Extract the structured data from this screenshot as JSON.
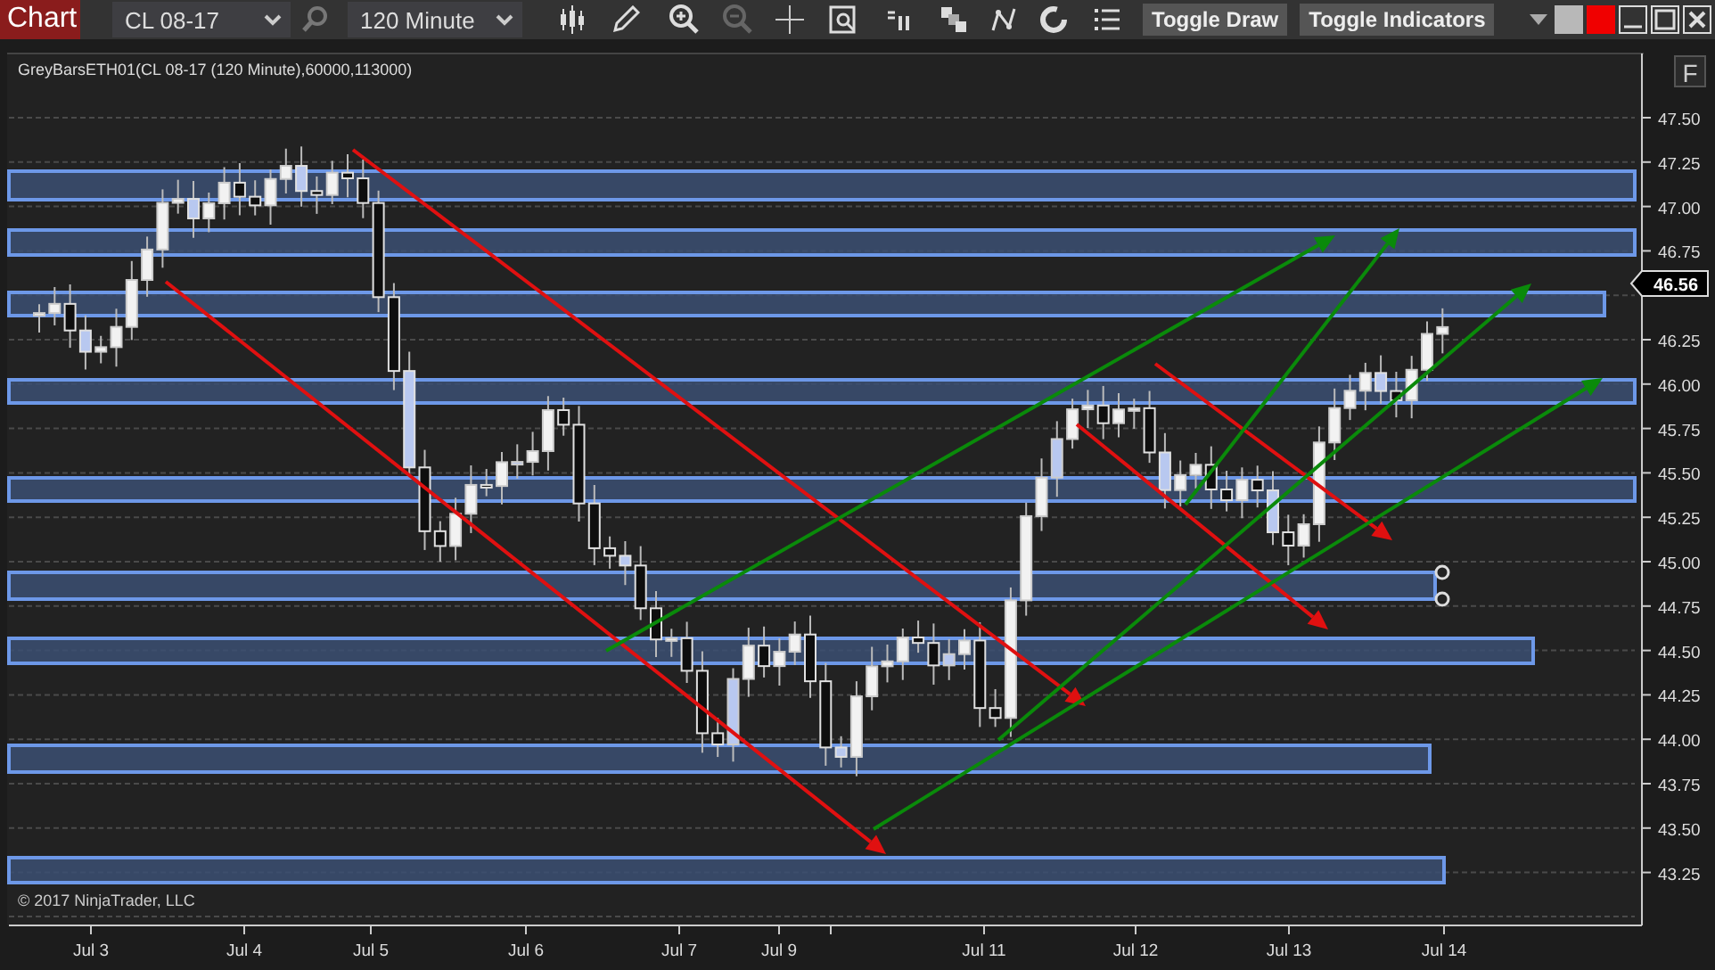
{
  "toolbar": {
    "app_title": "Chart",
    "instrument": "CL 08-17",
    "interval": "120 Minute",
    "buttons": [
      "Toggle Draw",
      "Toggle Indicators"
    ]
  },
  "chart": {
    "title": "GreyBarsETH01(CL 08-17 (120 Minute),60000,113000)",
    "panel_button": "F",
    "price_marker": "46.56",
    "y_axis_labels": [
      "47.50",
      "47.25",
      "47.00",
      "46.75",
      "46.25",
      "46.00",
      "45.75",
      "45.50",
      "45.25",
      "45.00",
      "44.75",
      "44.50",
      "44.25",
      "44.00",
      "43.75",
      "43.50",
      "43.25"
    ],
    "x_axis_labels": [
      "Jul 3",
      "Jul 4",
      "Jul 5",
      "Jul 6",
      "Jul 7",
      "Jul 9",
      "Jul 11",
      "Jul 12",
      "Jul 13",
      "Jul 14"
    ],
    "copyright": "© 2017 NinjaTrader, LLC"
  }
}
